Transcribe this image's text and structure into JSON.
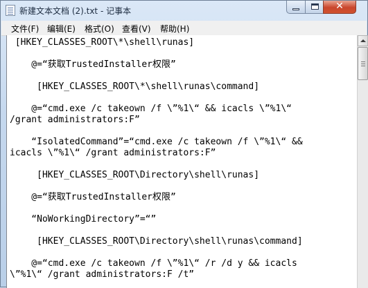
{
  "window": {
    "title": "新建文本文档 (2).txt - 记事本",
    "close_glyph": "✕"
  },
  "menu": {
    "items": [
      {
        "label": "文件(F)"
      },
      {
        "label": "编辑(E)"
      },
      {
        "label": "格式(O)"
      },
      {
        "label": "查看(V)"
      },
      {
        "label": "帮助(H)"
      }
    ]
  },
  "document": {
    "lines": [
      " [HKEY_CLASSES_ROOT\\*\\shell\\runas]",
      "",
      "    @=“获取TrustedInstaller权限”",
      "",
      "     [HKEY_CLASSES_ROOT\\*\\shell\\runas\\command]",
      "",
      "    @=“cmd.exe /c takeown /f \\”%1\\“ && icacls \\”%1\\“",
      "/grant administrators:F”",
      "",
      "    “IsolatedCommand”=“cmd.exe /c takeown /f \\”%1\\“ &&",
      "icacls \\”%1\\“ /grant administrators:F”",
      "",
      "     [HKEY_CLASSES_ROOT\\Directory\\shell\\runas]",
      "",
      "    @=“获取TrustedInstaller权限”",
      "",
      "    “NoWorkingDirectory”=“”",
      "",
      "     [HKEY_CLASSES_ROOT\\Directory\\shell\\runas\\command]",
      "",
      "    @=“cmd.exe /c takeown /f \\”%1\\“ /r /d y && icacls",
      "\\”%1\\“ /grant administrators:F /t”"
    ]
  }
}
